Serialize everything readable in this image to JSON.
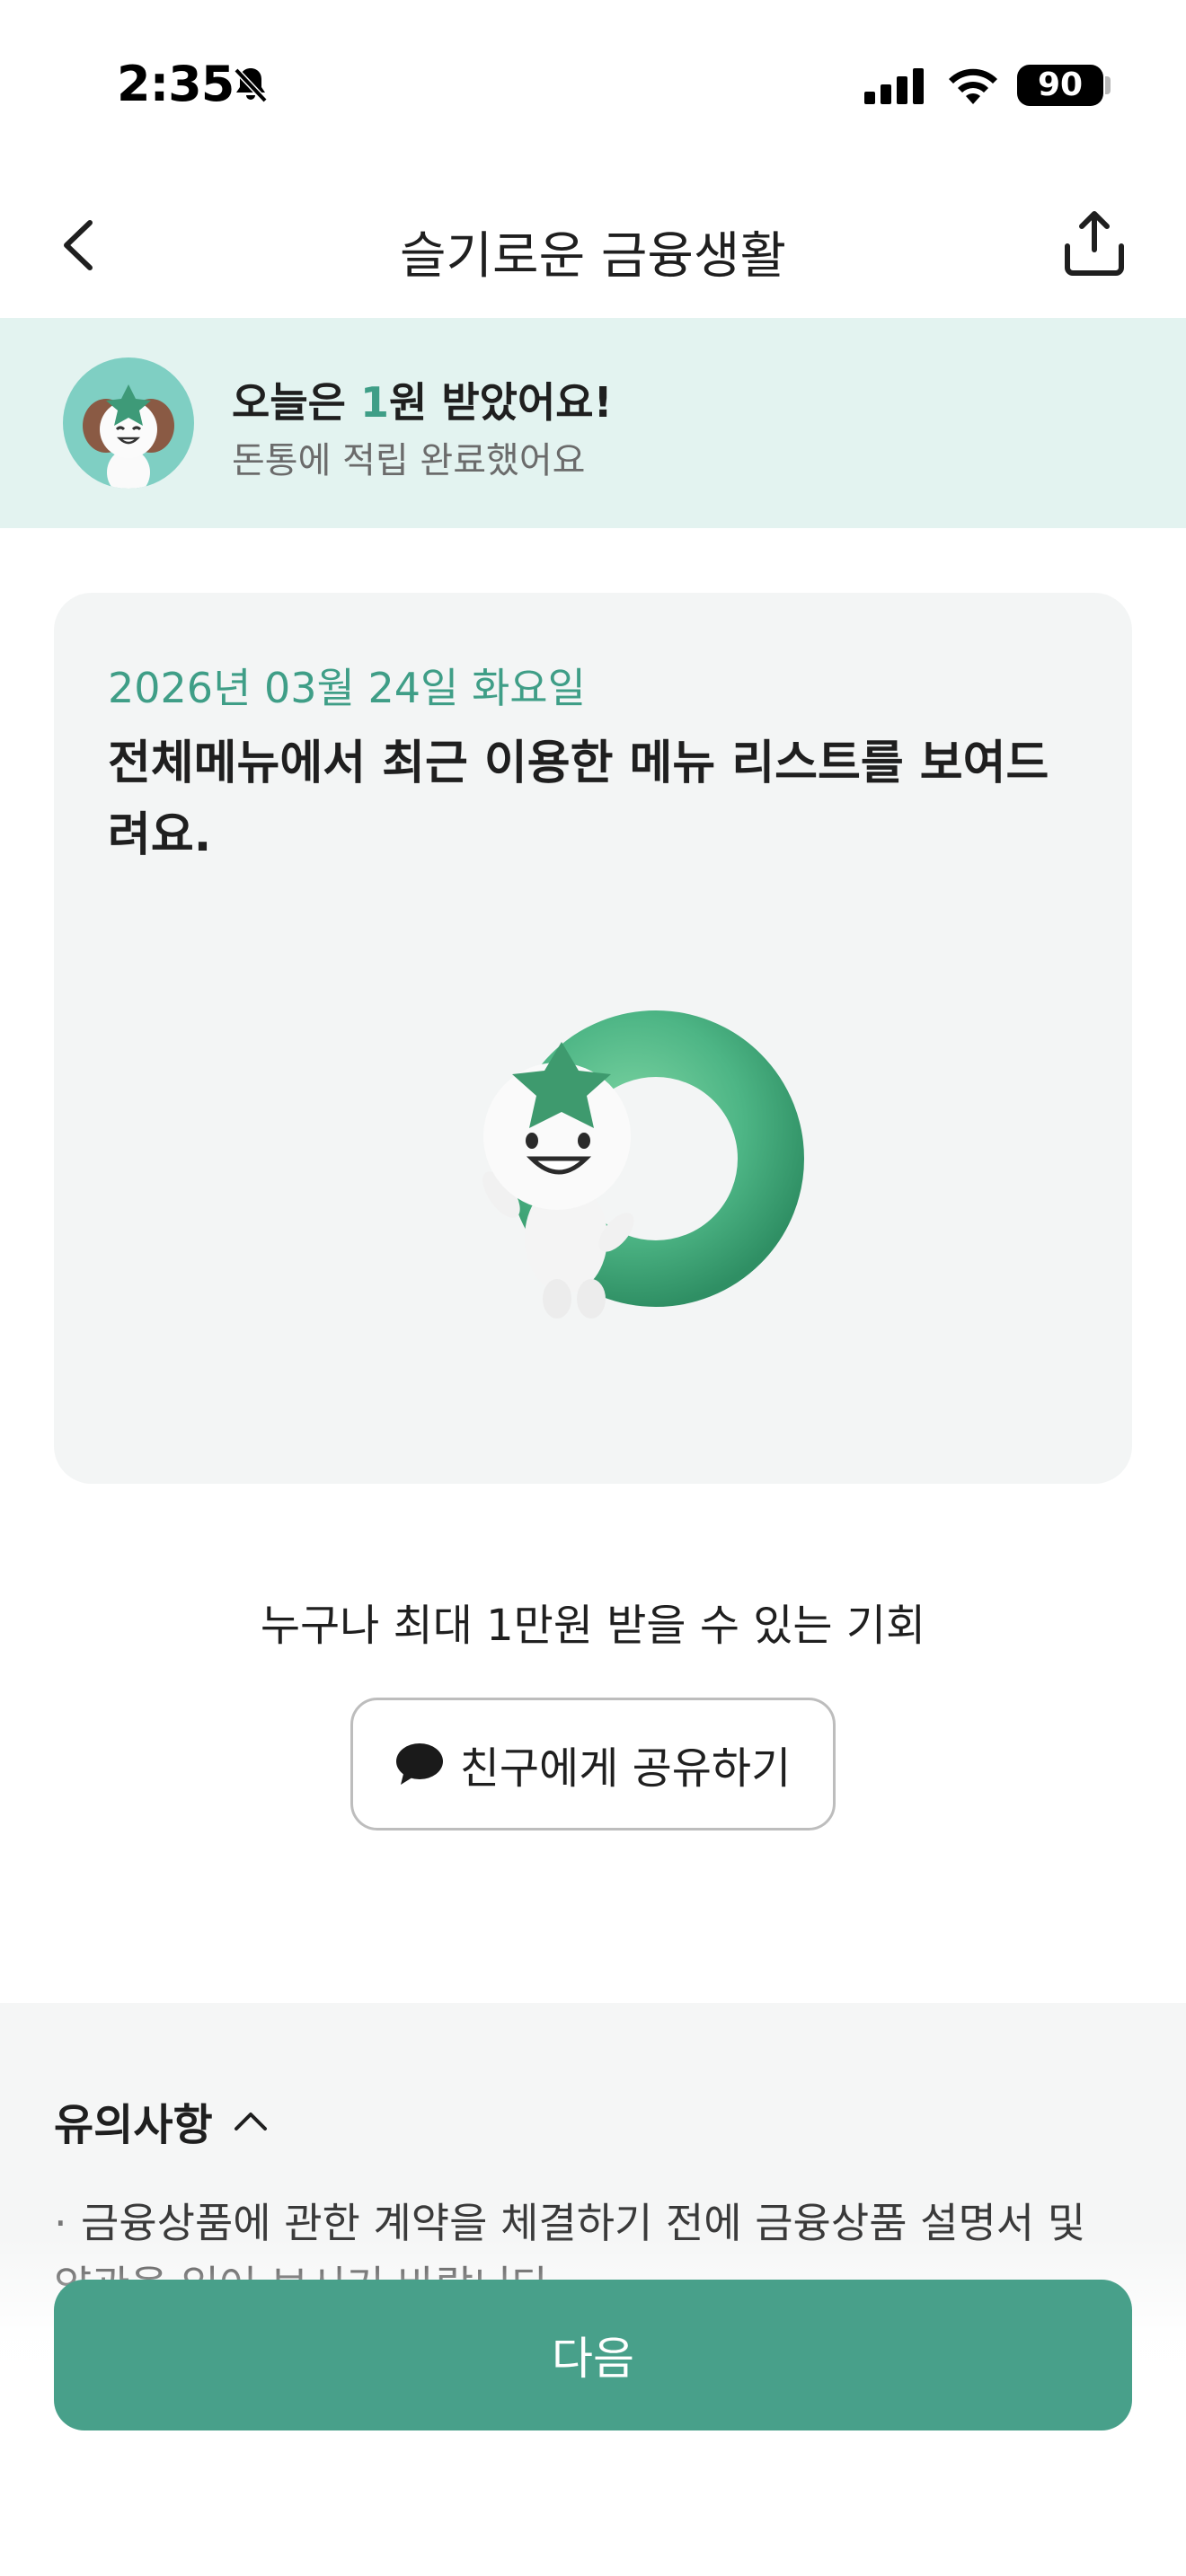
{
  "status_bar": {
    "time": "2:35",
    "battery": "90",
    "icons": [
      "bell-slash-icon",
      "signal-icon",
      "wifi-icon",
      "battery-icon"
    ]
  },
  "nav": {
    "title": "슬기로운 금융생활",
    "back_icon": "chevron-left-icon",
    "share_icon": "share-upload-icon"
  },
  "reward": {
    "title_prefix": "오늘은 ",
    "amount": "1",
    "title_suffix": "원 받았어요!",
    "subtitle": "돈통에 적립 완료했어요"
  },
  "tip_card": {
    "date": "2026년 03월 24일 화요일",
    "text": "전체메뉴에서 최근 이용한 메뉴 리스트를 보여드려요."
  },
  "promo": {
    "text": "누구나 최대 1만원 받을 수 있는 기회",
    "share_button_label": "친구에게 공유하기",
    "share_button_icon": "chat-bubble-icon"
  },
  "notice": {
    "title": "유의사항",
    "toggle_icon": "chevron-up-icon",
    "items": [
      "금융상품에 관한 계약을 체결하기 전에 금융상품 설명서 및 약관을 읽어 보시기 바랍니다."
    ]
  },
  "footer": {
    "next_label": "다음"
  },
  "colors": {
    "accent": "#48a08a",
    "accent_text": "#3f9e87",
    "banner_bg": "#e3f3f0",
    "card_bg": "#f3f5f5"
  }
}
